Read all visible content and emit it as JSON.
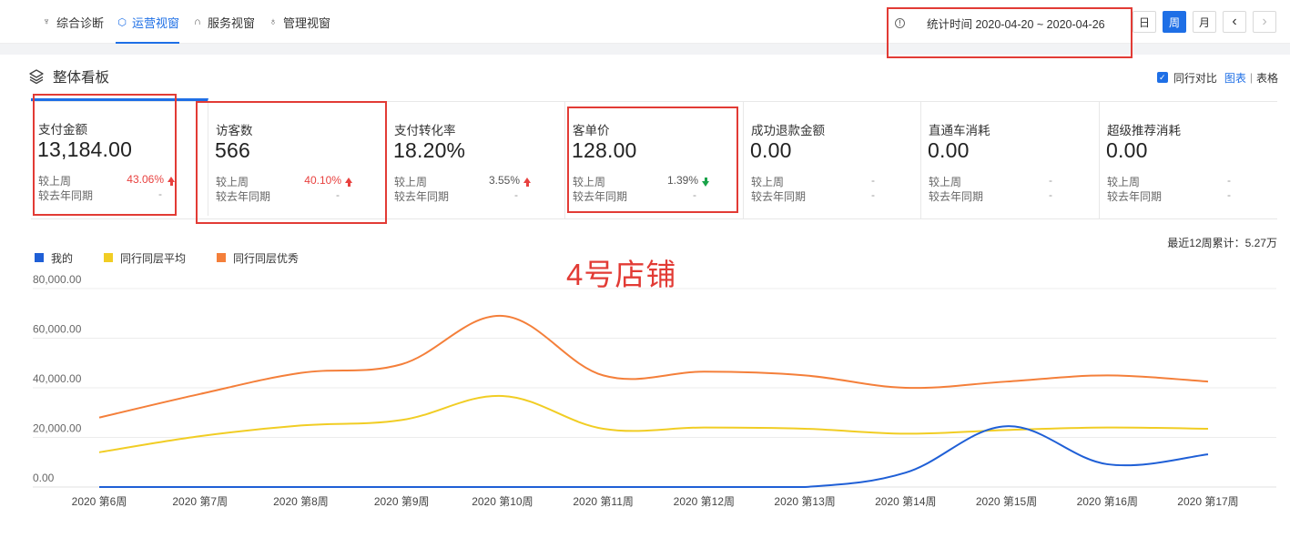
{
  "nav": {
    "tabs": [
      {
        "label": "综合诊断",
        "icon": "diagnosis-icon",
        "active": false
      },
      {
        "label": "运营视窗",
        "icon": "operation-icon",
        "active": true
      },
      {
        "label": "服务视窗",
        "icon": "headset-icon",
        "active": false
      },
      {
        "label": "管理视窗",
        "icon": "manage-icon",
        "active": false
      }
    ],
    "stat_time": "统计时间 2020-04-20 ~ 2020-04-26",
    "period": {
      "day": "日",
      "week": "周",
      "month": "月",
      "active": "周"
    },
    "prev": "‹",
    "next": "›"
  },
  "panel": {
    "title": "整体看板",
    "peer_compare": "同行对比",
    "chart_view": "图表",
    "separator": "|",
    "table_view": "表格"
  },
  "cards": [
    {
      "label": "支付金额",
      "value": "13,184.00",
      "wow_label": "较上周",
      "wow": "43.06%",
      "wow_dir": "up",
      "yoy_label": "较去年同期",
      "yoy": "-",
      "selected": true
    },
    {
      "label": "访客数",
      "value": "566",
      "wow_label": "较上周",
      "wow": "40.10%",
      "wow_dir": "up",
      "yoy_label": "较去年同期",
      "yoy": "-",
      "selected": false
    },
    {
      "label": "支付转化率",
      "value": "18.20%",
      "wow_label": "较上周",
      "wow": "3.55%",
      "wow_dir": "up-neutral",
      "yoy_label": "较去年同期",
      "yoy": "-",
      "selected": false
    },
    {
      "label": "客单价",
      "value": "128.00",
      "wow_label": "较上周",
      "wow": "1.39%",
      "wow_dir": "down",
      "yoy_label": "较去年同期",
      "yoy": "-",
      "selected": false
    },
    {
      "label": "成功退款金额",
      "value": "0.00",
      "wow_label": "较上周",
      "wow": "-",
      "wow_dir": "flat",
      "yoy_label": "较去年同期",
      "yoy": "-",
      "selected": false
    },
    {
      "label": "直通车消耗",
      "value": "0.00",
      "wow_label": "较上周",
      "wow": "-",
      "wow_dir": "flat",
      "yoy_label": "较去年同期",
      "yoy": "-",
      "selected": false
    },
    {
      "label": "超级推荐消耗",
      "value": "0.00",
      "wow_label": "较上周",
      "wow": "-",
      "wow_dir": "flat",
      "yoy_label": "较去年同期",
      "yoy": "-",
      "selected": false
    }
  ],
  "annotation": "4号店铺",
  "colors": {
    "accent": "#1e6fe6",
    "up": "#e8413f",
    "down": "#1aa34a",
    "annotation": "#e23b35"
  },
  "chart_data": {
    "type": "line",
    "cumulative_label": "最近12周累计：5.27万",
    "categories": [
      "2020 第6周",
      "2020 第7周",
      "2020 第8周",
      "2020 第9周",
      "2020 第10周",
      "2020 第11周",
      "2020 第12周",
      "2020 第13周",
      "2020 第14周",
      "2020 第15周",
      "2020 第16周",
      "2020 第17周"
    ],
    "yticks": [
      "0.00",
      "20,000.00",
      "40,000.00",
      "60,000.00",
      "80,000.00"
    ],
    "ylim": [
      0,
      80000
    ],
    "legend_position": "top-left",
    "grid": true,
    "series": [
      {
        "name": "我的",
        "color": "#1f5fd6",
        "values": [
          0,
          0,
          0,
          0,
          0,
          0,
          0,
          0,
          5800,
          24500,
          9200,
          13184
        ]
      },
      {
        "name": "同行同层平均",
        "color": "#f1cd24",
        "values": [
          14000,
          20500,
          24800,
          27000,
          36700,
          23500,
          24000,
          23500,
          21500,
          23000,
          24000,
          23500
        ]
      },
      {
        "name": "同行同层优秀",
        "color": "#f47f3a",
        "values": [
          28000,
          37500,
          46000,
          49500,
          69000,
          45000,
          46500,
          45000,
          40000,
          42500,
          45000,
          42500
        ]
      }
    ]
  }
}
